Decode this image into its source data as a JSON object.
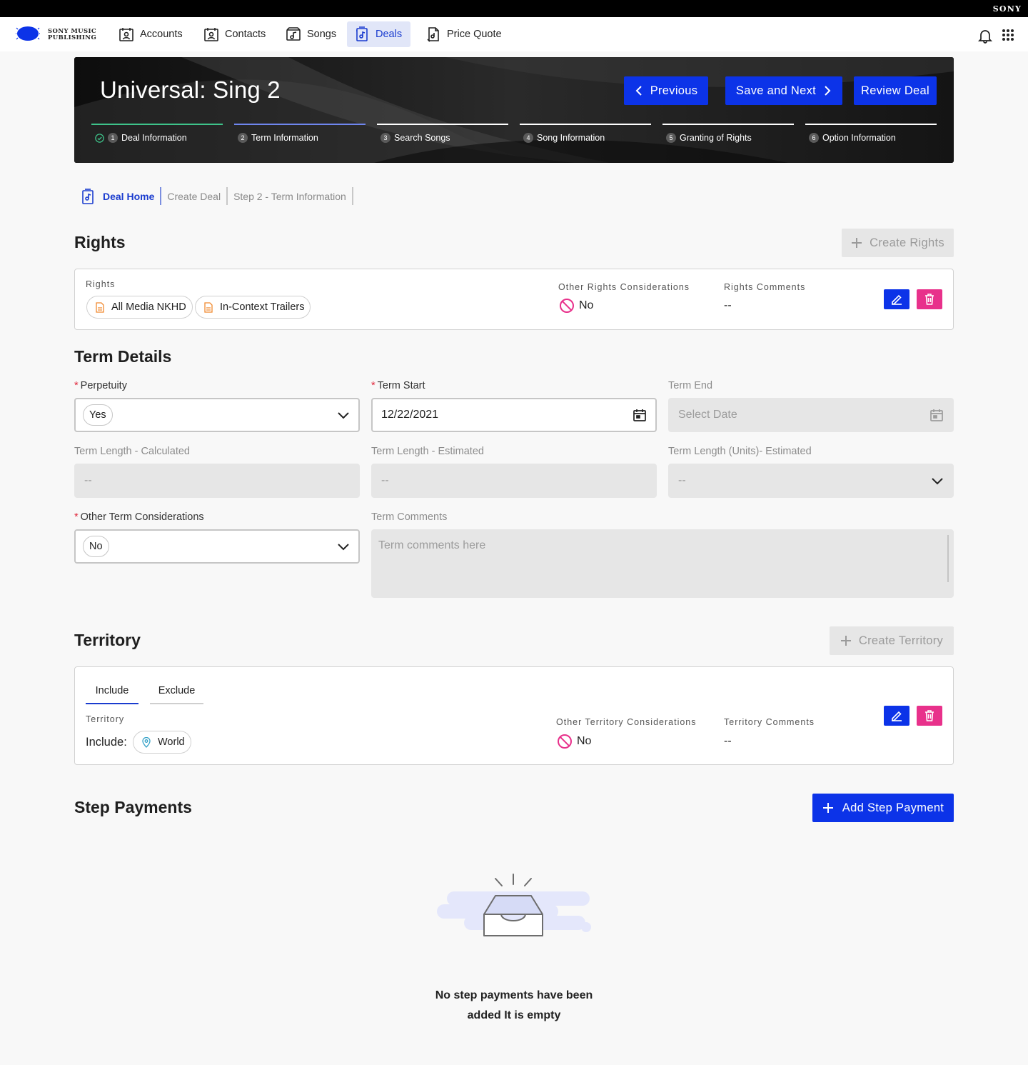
{
  "brand": {
    "sony": "SONY",
    "logo_line1": "SONY MUSIC",
    "logo_line2": "PUBLISHING"
  },
  "nav": {
    "items": [
      {
        "label": "Accounts",
        "icon": "accounts-icon"
      },
      {
        "label": "Contacts",
        "icon": "contacts-icon"
      },
      {
        "label": "Songs",
        "icon": "songs-icon"
      },
      {
        "label": "Deals",
        "icon": "deals-icon",
        "active": true
      },
      {
        "label": "Price Quote",
        "icon": "price-quote-icon"
      }
    ]
  },
  "hero": {
    "title": "Universal: Sing 2",
    "buttons": {
      "previous": "Previous",
      "save_next": "Save and Next",
      "review": "Review Deal"
    },
    "steps": [
      {
        "num": "1",
        "label": "Deal Information",
        "status": "complete"
      },
      {
        "num": "2",
        "label": "Term Information",
        "status": "current"
      },
      {
        "num": "3",
        "label": "Search Songs",
        "status": "upcoming"
      },
      {
        "num": "4",
        "label": "Song Information",
        "status": "upcoming"
      },
      {
        "num": "5",
        "label": "Granting of Rights",
        "status": "upcoming"
      },
      {
        "num": "6",
        "label": "Option Information",
        "status": "upcoming"
      }
    ]
  },
  "breadcrumbs": [
    "Deal Home",
    "Create Deal",
    "Step 2 - Term Information"
  ],
  "rights": {
    "title": "Rights",
    "create_button": "Create Rights",
    "card": {
      "rights_label": "Rights",
      "chips": [
        "All Media NKHD",
        "In-Context Trailers"
      ],
      "other_label": "Other Rights Considerations",
      "other_value": "No",
      "comments_label": "Rights Comments",
      "comments_value": "--"
    }
  },
  "term": {
    "title": "Term Details",
    "perpetuity": {
      "label": "Perpetuity",
      "value": "Yes"
    },
    "term_start": {
      "label": "Term Start",
      "value": "12/22/2021"
    },
    "term_end": {
      "label": "Term End",
      "placeholder": "Select Date"
    },
    "length_calc": {
      "label": "Term Length - Calculated",
      "value": "--"
    },
    "length_est": {
      "label": "Term Length - Estimated",
      "value": "--"
    },
    "length_units": {
      "label": "Term Length (Units)- Estimated",
      "value": "--"
    },
    "other": {
      "label": "Other Term Considerations",
      "value": "No"
    },
    "comments": {
      "label": "Term Comments",
      "placeholder": "Term comments here"
    }
  },
  "territory": {
    "title": "Territory",
    "create_button": "Create Territory",
    "tabs": [
      "Include",
      "Exclude"
    ],
    "territory_label": "Territory",
    "include_label": "Include:",
    "include_chip": "World",
    "other_label": "Other Territory Considerations",
    "other_value": "No",
    "comments_label": "Territory Comments",
    "comments_value": "--"
  },
  "payments": {
    "title": "Step Payments",
    "add_button": "Add Step Payment",
    "empty_line1": "No step payments have been",
    "empty_line2": "added It is empty"
  },
  "colors": {
    "primary": "#0c33e8",
    "delete": "#e8318b",
    "complete": "#3ec38a",
    "active_step": "#6f86ef",
    "no_icon": "#e8318b"
  }
}
